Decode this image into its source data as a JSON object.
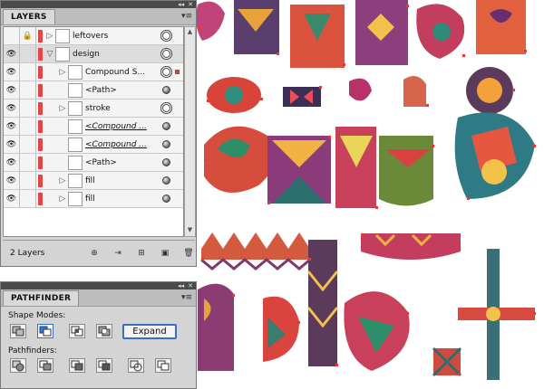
{
  "layers_panel": {
    "title": "LAYERS",
    "menu_icon": "panel-menu-icon",
    "rows": [
      {
        "name": "leftovers",
        "visible": false,
        "locked": true,
        "twirl": "collapsed",
        "indent": 0,
        "target": "ring",
        "selected": false
      },
      {
        "name": "design",
        "visible": true,
        "locked": false,
        "twirl": "expanded",
        "indent": 0,
        "target": "ring",
        "selected": true
      },
      {
        "name": "Compound S...",
        "visible": true,
        "locked": false,
        "twirl": "collapsed",
        "indent": 1,
        "target": "ring-double",
        "selected": false
      },
      {
        "name": "<Path>",
        "visible": true,
        "locked": false,
        "twirl": "none",
        "indent": 1,
        "target": "filled",
        "selected": false
      },
      {
        "name": "stroke",
        "visible": true,
        "locked": false,
        "twirl": "collapsed",
        "indent": 1,
        "target": "ring",
        "selected": false
      },
      {
        "name": "<Compound ...",
        "visible": true,
        "locked": false,
        "twirl": "none",
        "indent": 1,
        "target": "filled",
        "selected": false
      },
      {
        "name": "<Compound ...",
        "visible": true,
        "locked": false,
        "twirl": "none",
        "indent": 1,
        "target": "filled",
        "selected": false
      },
      {
        "name": "<Path>",
        "visible": true,
        "locked": false,
        "twirl": "none",
        "indent": 1,
        "target": "filled",
        "selected": false
      },
      {
        "name": "fill",
        "visible": true,
        "locked": false,
        "twirl": "collapsed",
        "indent": 1,
        "target": "filled",
        "selected": false
      },
      {
        "name": "fill",
        "visible": true,
        "locked": false,
        "twirl": "collapsed",
        "indent": 1,
        "target": "filled",
        "selected": false
      }
    ],
    "footer": {
      "count_label": "2 Layers"
    }
  },
  "pathfinder_panel": {
    "title": "PATHFINDER",
    "shape_modes_label": "Shape Modes:",
    "pathfinders_label": "Pathfinders:",
    "expand_label": "Expand"
  },
  "colors": {
    "layer_color": "#e04848",
    "selection": "#e33333",
    "expand_border": "#3a6ec4"
  }
}
